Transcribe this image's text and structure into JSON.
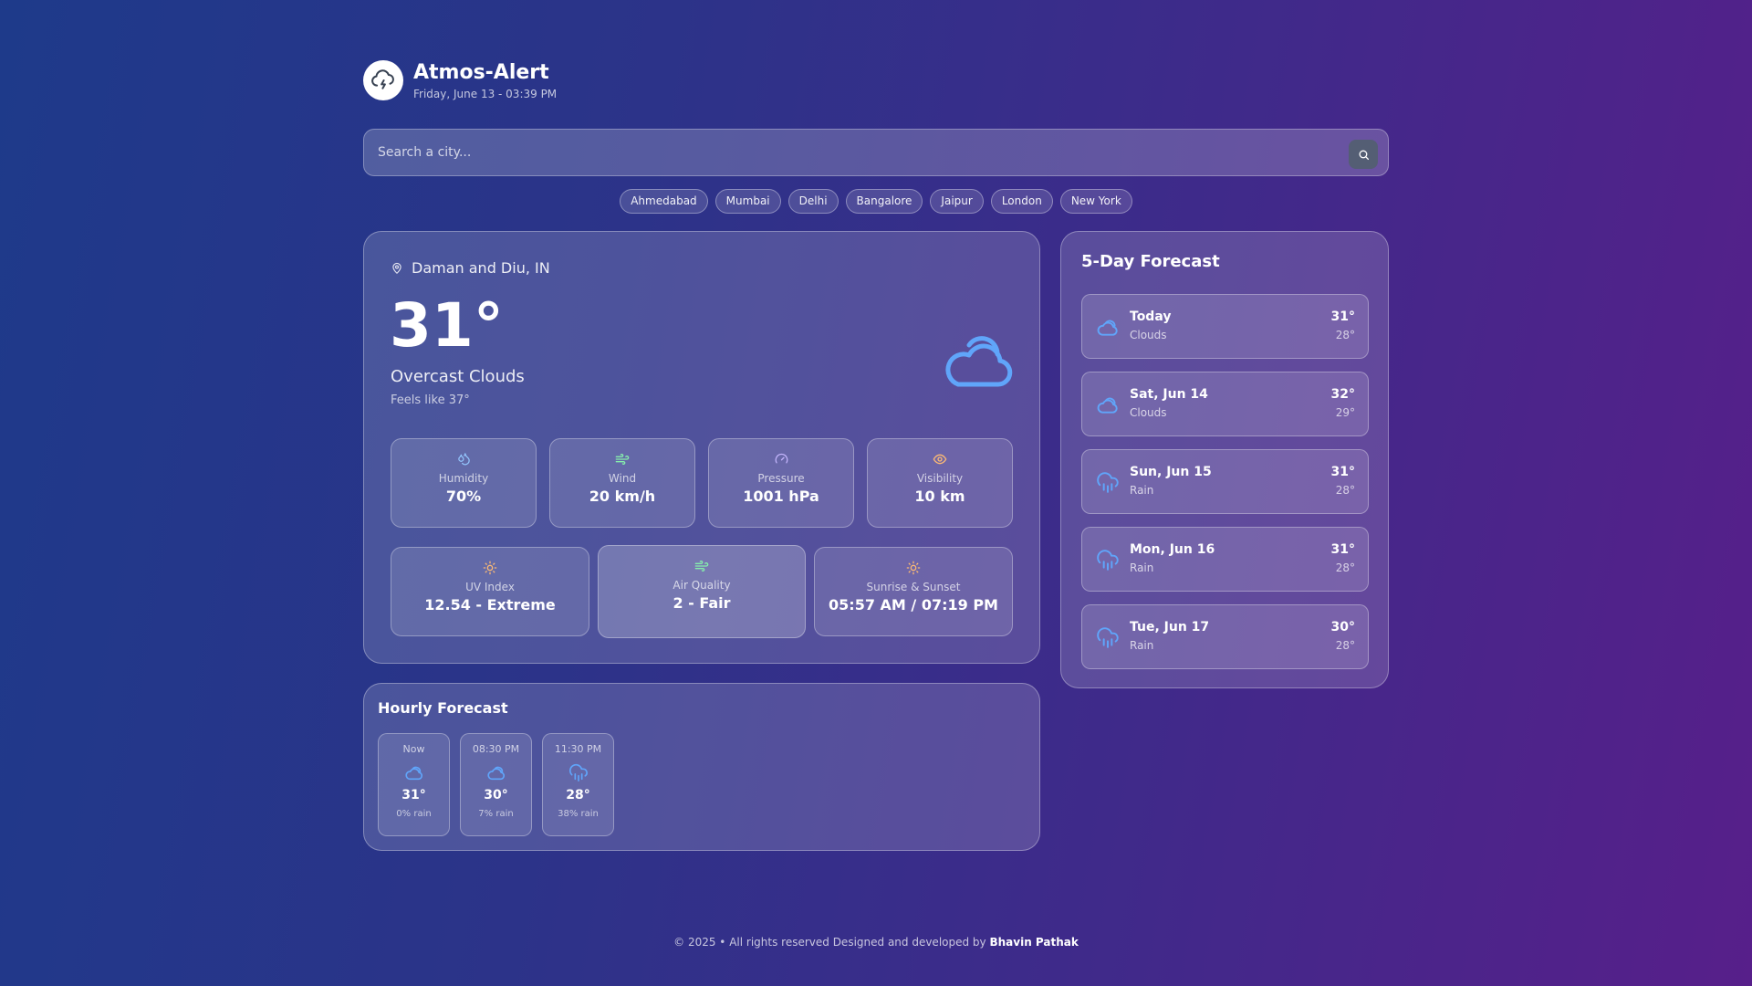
{
  "app": {
    "title": "Atmos-Alert",
    "datetime": "Friday, June 13 - 03:39 PM"
  },
  "search": {
    "placeholder": "Search a city..."
  },
  "quick_cities": [
    "Ahmedabad",
    "Mumbai",
    "Delhi",
    "Bangalore",
    "Jaipur",
    "London",
    "New York"
  ],
  "current": {
    "location": "Daman and Diu, IN",
    "temperature": "31°",
    "condition": "Overcast Clouds",
    "feels_like": "Feels like 37°",
    "stats": {
      "humidity": {
        "label": "Humidity",
        "value": "70%"
      },
      "wind": {
        "label": "Wind",
        "value": "20 km/h"
      },
      "pressure": {
        "label": "Pressure",
        "value": "1001 hPa"
      },
      "visibility": {
        "label": "Visibility",
        "value": "10 km"
      },
      "uv": {
        "label": "UV Index",
        "value": "12.54 - Extreme"
      },
      "air_quality": {
        "label": "Air Quality",
        "value": "2 - Fair"
      },
      "sun": {
        "label": "Sunrise & Sunset",
        "value": "05:57 AM / 07:19 PM"
      }
    }
  },
  "forecast": {
    "title": "5-Day Forecast",
    "days": [
      {
        "name": "Today",
        "condition": "Clouds",
        "high": "31°",
        "low": "28°",
        "icon": "cloud-icon"
      },
      {
        "name": "Sat, Jun 14",
        "condition": "Clouds",
        "high": "32°",
        "low": "29°",
        "icon": "cloud-icon"
      },
      {
        "name": "Sun, Jun 15",
        "condition": "Rain",
        "high": "31°",
        "low": "28°",
        "icon": "rain-cloud-icon"
      },
      {
        "name": "Mon, Jun 16",
        "condition": "Rain",
        "high": "31°",
        "low": "28°",
        "icon": "rain-cloud-icon"
      },
      {
        "name": "Tue, Jun 17",
        "condition": "Rain",
        "high": "30°",
        "low": "28°",
        "icon": "rain-cloud-icon"
      }
    ]
  },
  "hourly": {
    "title": "Hourly Forecast",
    "items": [
      {
        "time": "Now",
        "temp": "31°",
        "rain": "0% rain",
        "icon": "cloud-icon"
      },
      {
        "time": "08:30 PM",
        "temp": "30°",
        "rain": "7% rain",
        "icon": "cloud-icon"
      },
      {
        "time": "11:30 PM",
        "temp": "28°",
        "rain": "38% rain",
        "icon": "rain-cloud-icon"
      }
    ]
  },
  "footer": {
    "text": "© 2025 • All rights reserved Designed and developed by",
    "author": "Bhavin Pathak"
  },
  "colors": {
    "icon_blue": "#60a5fa",
    "wind_green": "#86efac",
    "sun_orange": "#fdba74"
  }
}
